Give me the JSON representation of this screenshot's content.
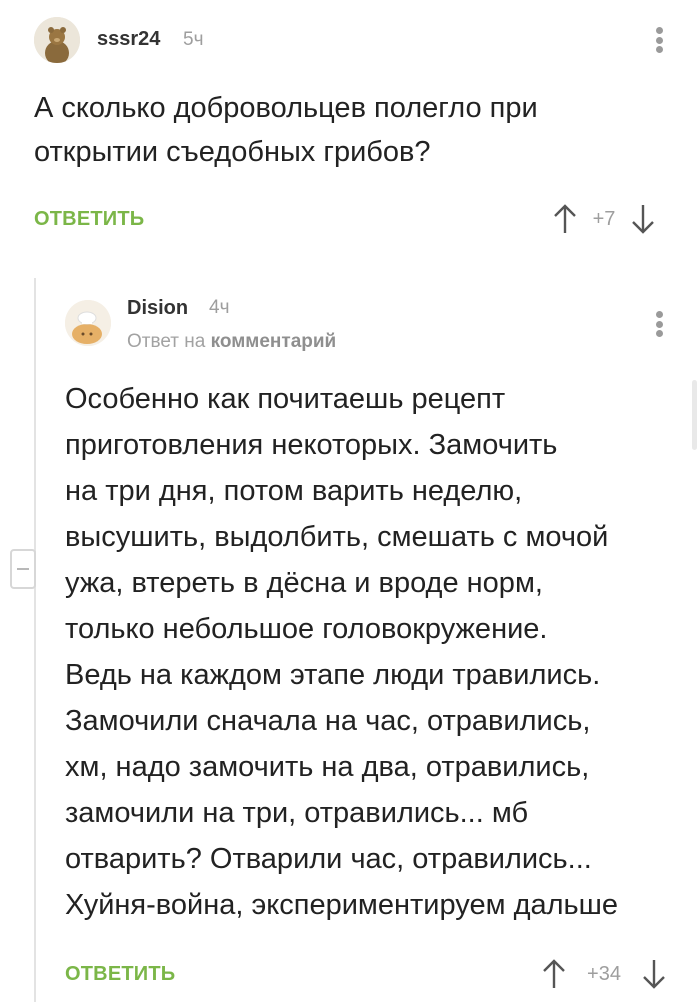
{
  "comments": {
    "top": {
      "author": "sssr24",
      "time": "5ч",
      "text": "А сколько добровольцев полегло при\nоткрытии съедобных грибов?",
      "reply_label": "ОТВЕТИТЬ",
      "rating": "+7"
    },
    "reply": {
      "author": "Dision",
      "time": "4ч",
      "reply_to_prefix": "Ответ на",
      "reply_to_link": "комментарий",
      "text": "Особенно как почитаешь рецепт\nприготовления некоторых. Замочить\nна три дня, потом варить неделю,\nвысушить, выдолбить, смешать с мочой\nужа, втереть в дёсна и вроде норм,\nтолько небольшое головокружение.\nВедь на каждом этапе люди травились.\nЗамочили сначала на час, отравились,\nхм, надо замочить на два, отравились,\nзамочили на три, отравились... мб\nотварить? Отварили час, отравились...\nХуйня-война, экспериментируем дальше",
      "reply_label": "ОТВЕТИТЬ",
      "rating": "+34"
    }
  },
  "colors": {
    "accent": "#7bb648",
    "muted": "#9e9e9e",
    "text": "#222222"
  },
  "icons": {
    "menu": "three-vertical-dots",
    "upvote": "arrow-up",
    "downvote": "arrow-down",
    "collapse": "minus-square"
  }
}
